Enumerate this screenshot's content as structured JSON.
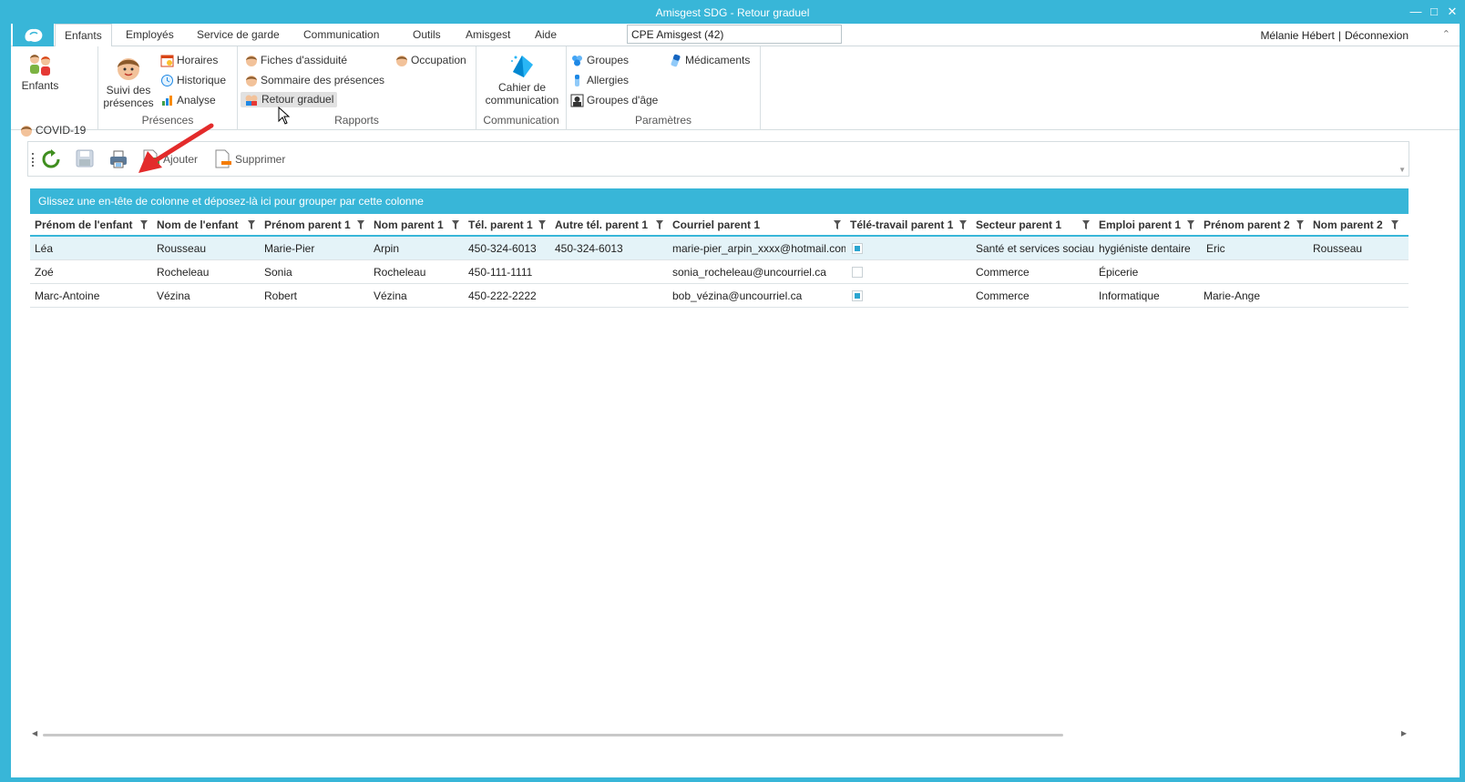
{
  "window": {
    "title": "Amisgest SDG - Retour graduel"
  },
  "tabs": [
    {
      "label": "Enfants",
      "active": true
    },
    {
      "label": "Employés"
    },
    {
      "label": "Service de garde"
    },
    {
      "label": "Communication"
    },
    {
      "label": "Outils"
    },
    {
      "label": "Amisgest"
    },
    {
      "label": "Aide"
    }
  ],
  "org_select": {
    "value": "CPE Amisgest (42)"
  },
  "user": {
    "name": "Mélanie Hébert",
    "separator": "|",
    "logout": "Déconnexion"
  },
  "ribbon": {
    "enfants": {
      "big_label": "Enfants",
      "covid": "COVID-19"
    },
    "presences": {
      "label": "Présences",
      "suivi_line1": "Suivi des",
      "suivi_line2": "présences",
      "horaires": "Horaires",
      "historique": "Historique",
      "analyse": "Analyse"
    },
    "rapports": {
      "label": "Rapports",
      "fiches": "Fiches d'assiduité",
      "sommaire": "Sommaire des présences",
      "retour": "Retour graduel",
      "occupation": "Occupation"
    },
    "communication": {
      "label": "Communication",
      "cahier_line1": "Cahier de",
      "cahier_line2": "communication"
    },
    "parametres": {
      "label": "Paramètres",
      "groupes": "Groupes",
      "allergies": "Allergies",
      "groupes_age": "Groupes d'âge",
      "medicaments": "Médicaments"
    }
  },
  "toolbar": {
    "add": "Ajouter",
    "delete": "Supprimer"
  },
  "group_panel": {
    "text": "Glissez une en-tête de colonne et déposez-là ici pour grouper par cette colonne"
  },
  "grid": {
    "columns": [
      "Prénom de l'enfant",
      "Nom de l'enfant",
      "Prénom parent 1",
      "Nom parent 1",
      "Tél. parent 1",
      "Autre tél. parent 1",
      "Courriel parent 1",
      "Télé-travail parent 1",
      "Secteur parent 1",
      "Emploi parent 1",
      "Prénom parent 2",
      "Nom parent 2"
    ],
    "rows": [
      [
        "Léa",
        "Rousseau",
        "Marie-Pier",
        "Arpin",
        "450-324-6013",
        "450-324-6013",
        "marie-pier_arpin_xxxx@hotmail.com",
        true,
        "Santé et services sociaux",
        "hygiéniste dentaire",
        "Eric",
        "Rousseau"
      ],
      [
        "Zoé",
        "Rocheleau",
        "Sonia",
        "Rocheleau",
        "450-111-1111",
        "",
        "sonia_rocheleau@uncourriel.ca",
        false,
        "Commerce",
        "Épicerie",
        "",
        ""
      ],
      [
        "Marc-Antoine",
        "Vézina",
        "Robert",
        "Vézina",
        "450-222-2222",
        "",
        "bob_vézina@uncourriel.ca",
        true,
        "Commerce",
        "Informatique",
        "Marie-Ange",
        ""
      ]
    ]
  },
  "colors": {
    "accent": "#38b6d8",
    "arrow": "#e32b2b",
    "selected_row": "#e4f3f8"
  }
}
